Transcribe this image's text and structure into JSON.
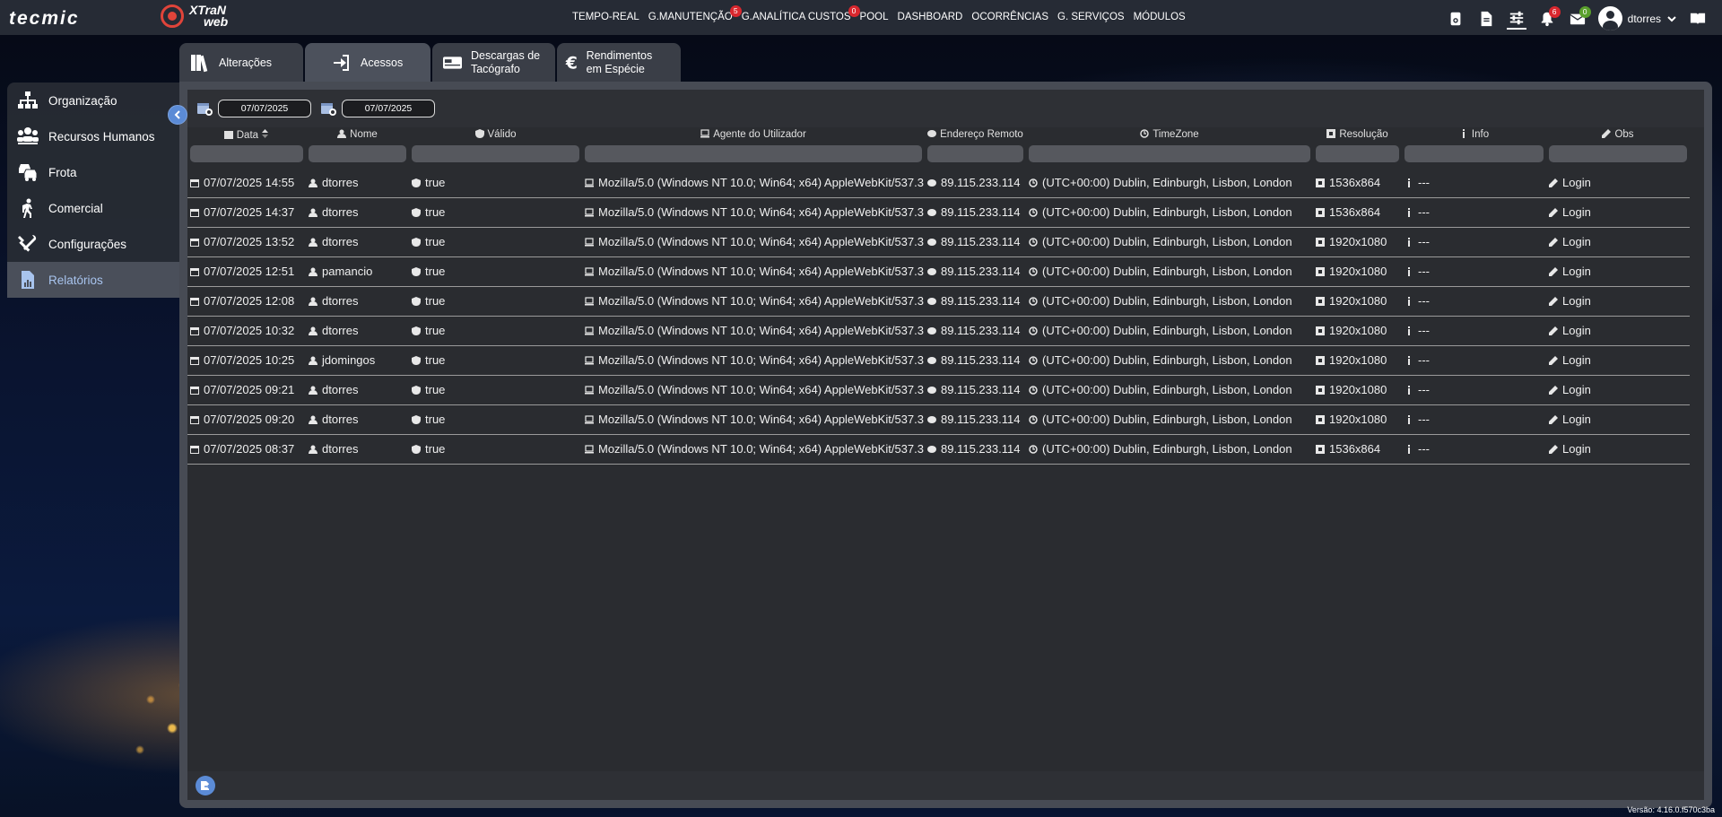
{
  "brand": {
    "tecmic": "tecmic",
    "xtran_top": "XTraN",
    "xtran_bottom": "web"
  },
  "nav": [
    {
      "label": "TEMPO-REAL",
      "badge": ""
    },
    {
      "label": "G.MANUTENÇÃO",
      "badge": "5"
    },
    {
      "label": "G.ANALÍTICA CUSTOS",
      "badge": "0"
    },
    {
      "label": "POOL",
      "badge": ""
    },
    {
      "label": "DASHBOARD",
      "badge": ""
    },
    {
      "label": "OCORRÊNCIAS",
      "badge": ""
    },
    {
      "label": "G. SERVIÇOS",
      "badge": ""
    },
    {
      "label": "MÓDULOS",
      "badge": ""
    }
  ],
  "top_icons": {
    "notifications_badge": "6",
    "messages_badge": "0",
    "username": "dtorres"
  },
  "sidebar": {
    "items": [
      {
        "label": "Organização",
        "icon": "org-chart-icon"
      },
      {
        "label": "Recursos Humanos",
        "icon": "people-icon"
      },
      {
        "label": "Frota",
        "icon": "cars-icon"
      },
      {
        "label": "Comercial",
        "icon": "walking-icon"
      },
      {
        "label": "Configurações",
        "icon": "tools-icon"
      },
      {
        "label": "Relatórios",
        "icon": "report-icon",
        "active": true
      }
    ]
  },
  "tabs": [
    {
      "label": "Alterações",
      "icon": "books-icon"
    },
    {
      "label": "Acessos",
      "icon": "sign-in-icon",
      "active": true
    },
    {
      "label": "Descargas de Tacógrafo",
      "icon": "card-icon"
    },
    {
      "label": "Rendimentos em Espécie",
      "icon": "euro-icon"
    }
  ],
  "filters": {
    "date_from": "07/07/2025",
    "date_to": "07/07/2025"
  },
  "columns": [
    "Data",
    "Nome",
    "Válido",
    "Agente do Utilizador",
    "Endereço Remoto",
    "TimeZone",
    "Resolução",
    "Info",
    "Obs"
  ],
  "rows": [
    {
      "data": "07/07/2025 14:55",
      "nome": "dtorres",
      "valido": "true",
      "agente": "Mozilla/5.0 (Windows NT 10.0; Win64; x64) AppleWebKit/537.3",
      "ip": "89.115.233.114",
      "tz": "(UTC+00:00) Dublin, Edinburgh, Lisbon, London",
      "res": "1536x864",
      "info": "---",
      "obs": "Login"
    },
    {
      "data": "07/07/2025 14:37",
      "nome": "dtorres",
      "valido": "true",
      "agente": "Mozilla/5.0 (Windows NT 10.0; Win64; x64) AppleWebKit/537.3",
      "ip": "89.115.233.114",
      "tz": "(UTC+00:00) Dublin, Edinburgh, Lisbon, London",
      "res": "1536x864",
      "info": "---",
      "obs": "Login"
    },
    {
      "data": "07/07/2025 13:52",
      "nome": "dtorres",
      "valido": "true",
      "agente": "Mozilla/5.0 (Windows NT 10.0; Win64; x64) AppleWebKit/537.3",
      "ip": "89.115.233.114",
      "tz": "(UTC+00:00) Dublin, Edinburgh, Lisbon, London",
      "res": "1920x1080",
      "info": "---",
      "obs": "Login"
    },
    {
      "data": "07/07/2025 12:51",
      "nome": "pamancio",
      "valido": "true",
      "agente": "Mozilla/5.0 (Windows NT 10.0; Win64; x64) AppleWebKit/537.3",
      "ip": "89.115.233.114",
      "tz": "(UTC+00:00) Dublin, Edinburgh, Lisbon, London",
      "res": "1920x1080",
      "info": "---",
      "obs": "Login"
    },
    {
      "data": "07/07/2025 12:08",
      "nome": "dtorres",
      "valido": "true",
      "agente": "Mozilla/5.0 (Windows NT 10.0; Win64; x64) AppleWebKit/537.3",
      "ip": "89.115.233.114",
      "tz": "(UTC+00:00) Dublin, Edinburgh, Lisbon, London",
      "res": "1920x1080",
      "info": "---",
      "obs": "Login"
    },
    {
      "data": "07/07/2025 10:32",
      "nome": "dtorres",
      "valido": "true",
      "agente": "Mozilla/5.0 (Windows NT 10.0; Win64; x64) AppleWebKit/537.3",
      "ip": "89.115.233.114",
      "tz": "(UTC+00:00) Dublin, Edinburgh, Lisbon, London",
      "res": "1920x1080",
      "info": "---",
      "obs": "Login"
    },
    {
      "data": "07/07/2025 10:25",
      "nome": "jdomingos",
      "valido": "true",
      "agente": "Mozilla/5.0 (Windows NT 10.0; Win64; x64) AppleWebKit/537.3",
      "ip": "89.115.233.114",
      "tz": "(UTC+00:00) Dublin, Edinburgh, Lisbon, London",
      "res": "1920x1080",
      "info": "---",
      "obs": "Login"
    },
    {
      "data": "07/07/2025 09:21",
      "nome": "dtorres",
      "valido": "true",
      "agente": "Mozilla/5.0 (Windows NT 10.0; Win64; x64) AppleWebKit/537.3",
      "ip": "89.115.233.114",
      "tz": "(UTC+00:00) Dublin, Edinburgh, Lisbon, London",
      "res": "1920x1080",
      "info": "---",
      "obs": "Login"
    },
    {
      "data": "07/07/2025 09:20",
      "nome": "dtorres",
      "valido": "true",
      "agente": "Mozilla/5.0 (Windows NT 10.0; Win64; x64) AppleWebKit/537.3",
      "ip": "89.115.233.114",
      "tz": "(UTC+00:00) Dublin, Edinburgh, Lisbon, London",
      "res": "1920x1080",
      "info": "---",
      "obs": "Login"
    },
    {
      "data": "07/07/2025 08:37",
      "nome": "dtorres",
      "valido": "true",
      "agente": "Mozilla/5.0 (Windows NT 10.0; Win64; x64) AppleWebKit/537.3",
      "ip": "89.115.233.114",
      "tz": "(UTC+00:00) Dublin, Edinburgh, Lisbon, London",
      "res": "1536x864",
      "info": "---",
      "obs": "Login"
    }
  ],
  "version": "Versão: 4.16.0.f570c3ba"
}
